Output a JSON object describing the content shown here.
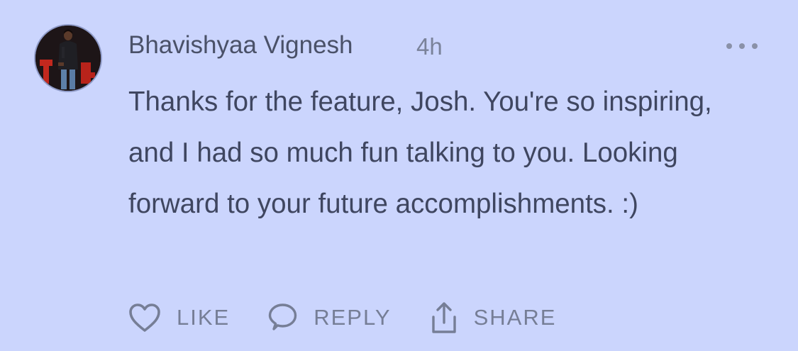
{
  "comment": {
    "author": "Bhavishyaa Vignesh",
    "timestamp": "4h",
    "body": "Thanks for the feature, Josh. You're so inspiring, and I had so much fun talking to you. Looking forward to your future accomplishments. :)",
    "avatar_icon": "user-photo",
    "more_icon": "ellipsis-icon"
  },
  "actions": {
    "like_label": "LIKE",
    "reply_label": "REPLY",
    "share_label": "SHARE"
  },
  "colors": {
    "background": "#cbd5fd",
    "text": "#3f4660",
    "muted": "#767e96"
  }
}
